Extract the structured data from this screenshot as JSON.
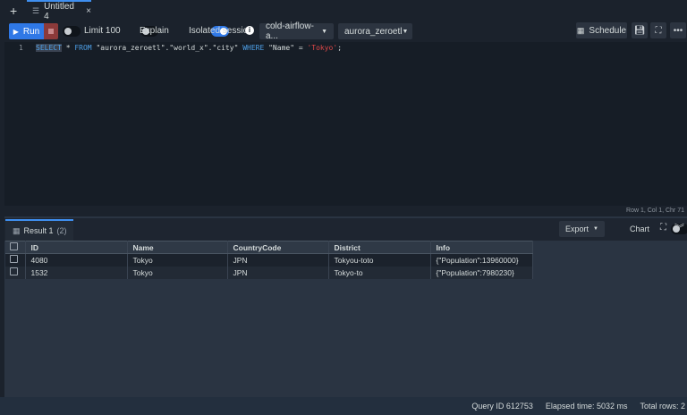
{
  "tabs": {
    "new_tab": "+",
    "active": "Untitled 4",
    "close": "×"
  },
  "toolbar": {
    "run": "Run",
    "limit": "Limit 100",
    "explain": "Explain",
    "isolated": "Isolated session",
    "info": "i",
    "connection": "cold-airflow-a...",
    "database": "aurora_zeroetl",
    "schedule": "Schedule"
  },
  "editor": {
    "line_number": "1",
    "code": {
      "kw1": "SELECT",
      "p1": " * ",
      "kw2": "FROM",
      "p2": " \"aurora_zeroetl\".\"world_x\".\"city\" ",
      "kw3": "WHERE",
      "p3": " \"Name\" = ",
      "str": "'Tokyo'",
      "p4": ";"
    },
    "status": "Row 1, Col 1, Chr 71"
  },
  "results": {
    "tab": "Result 1",
    "count": "(2)",
    "export": "Export",
    "chart": "Chart",
    "columns": [
      "ID",
      "Name",
      "CountryCode",
      "District",
      "Info"
    ],
    "rows": [
      [
        "4080",
        "Tokyo",
        "JPN",
        "Tokyou-toto",
        "{\"Population\":13960000}"
      ],
      [
        "1532",
        "Tokyo",
        "JPN",
        "Tokyo-to",
        "{\"Population\":7980230}"
      ]
    ]
  },
  "status": {
    "query_id": "Query ID 612753",
    "elapsed": "Elapsed time: 5032 ms",
    "total": "Total rows: 2"
  }
}
